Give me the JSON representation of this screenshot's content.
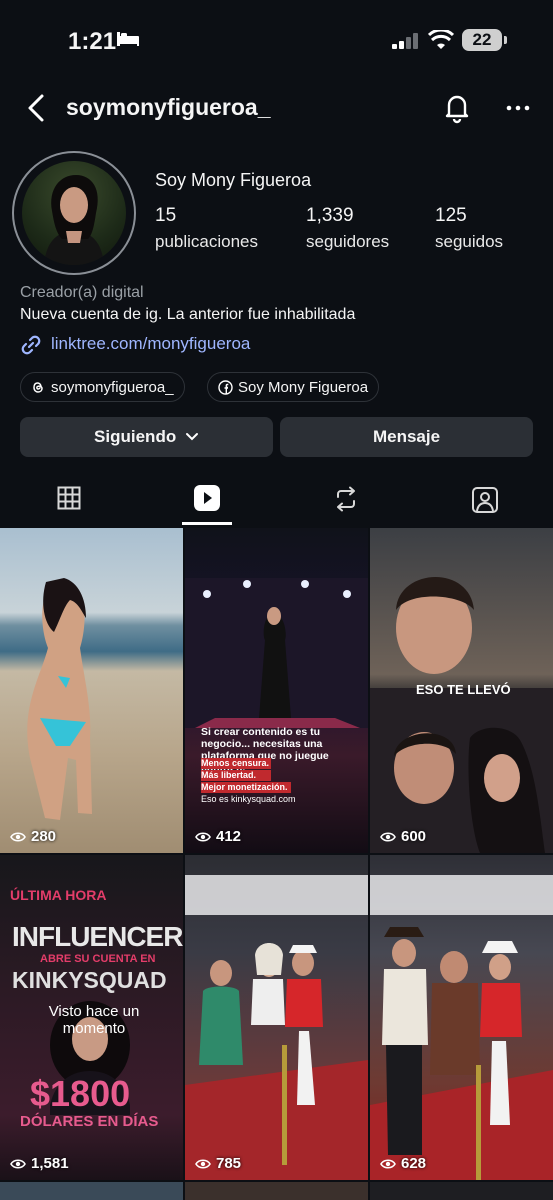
{
  "status": {
    "time": "1:21",
    "battery": "22"
  },
  "header": {
    "username": "soymonyfigueroa_"
  },
  "profile": {
    "display_name": "Soy Mony Figueroa",
    "stats": [
      {
        "value": "15",
        "label": "publicaciones"
      },
      {
        "value": "1,339",
        "label": "seguidores"
      },
      {
        "value": "125",
        "label": "seguidos"
      }
    ],
    "category": "Creador(a) digital",
    "bio": "Nueva cuenta de ig. La anterior fue inhabilitada",
    "link": "linktree.com/monyfigueroa",
    "chips": [
      {
        "icon": "threads-icon",
        "label": "soymonyfigueroa_"
      },
      {
        "icon": "facebook-icon",
        "label": "Soy Mony Figueroa"
      }
    ]
  },
  "actions": {
    "following_label": "Siguiendo",
    "message_label": "Mensaje"
  },
  "tabs": [
    "grid-icon",
    "reels-icon",
    "reposts-icon",
    "tagged-icon"
  ],
  "reels": [
    {
      "views": "280"
    },
    {
      "views": "412",
      "caption": "Si crear contenido es tu negocio... necesitas una plataforma que no juegue contra ti.",
      "bullets": [
        "Menos censura.",
        "Más libertad.",
        "Mejor monetización."
      ],
      "footer": "Eso es kinkysquad.com"
    },
    {
      "views": "600",
      "caption": "ESO TE LLEVÓ"
    },
    {
      "views": "1,581",
      "headline1": "ÚLTIMA HORA",
      "headline2": "INFLUENCER",
      "headline3": "ABRE SU CUENTA EN",
      "headline4": "KINKYSQUAD",
      "amount": "$1800",
      "amount_sub": "DÓLARES EN DÍAS",
      "seen": "Visto hace un momento"
    },
    {
      "views": "785"
    },
    {
      "views": "628"
    }
  ],
  "colors": {
    "background": "#0c0f14",
    "button": "#2b2f35",
    "link": "#9fb6ff"
  }
}
